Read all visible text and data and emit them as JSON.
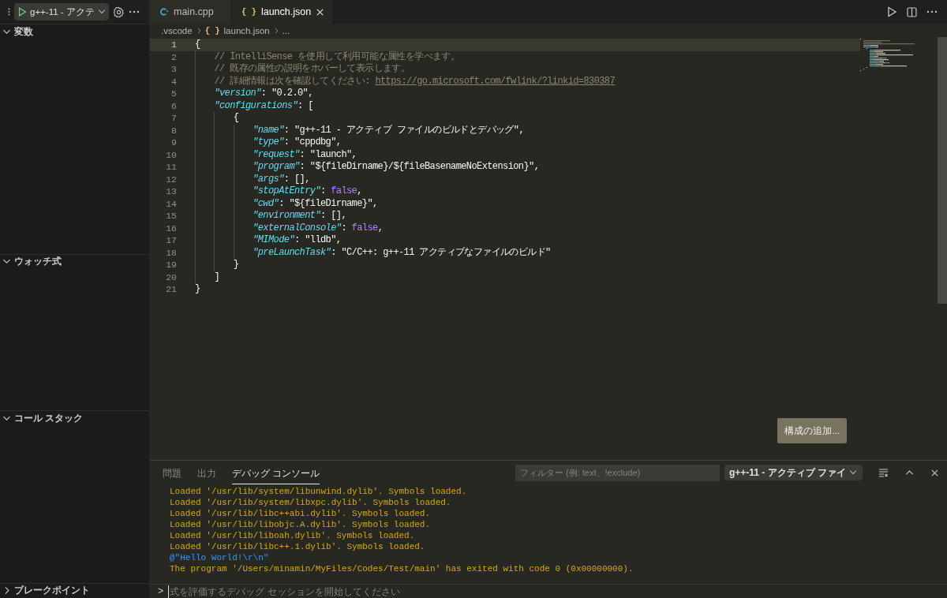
{
  "debug_toolbar": {
    "configuration": "g++-11 - アクテ"
  },
  "sidebar": {
    "sections": [
      {
        "title": "変数",
        "expanded": true
      },
      {
        "title": "ウォッチ式",
        "expanded": true
      },
      {
        "title": "コール スタック",
        "expanded": true
      },
      {
        "title": "ブレークポイント",
        "expanded": false
      }
    ]
  },
  "tabs": [
    {
      "label": "main.cpp",
      "kind": "cpp",
      "selected": false
    },
    {
      "label": "launch.json",
      "kind": "json",
      "icon_text": "{ }",
      "selected": true
    }
  ],
  "breadcrumb": [
    {
      "label": ".vscode"
    },
    {
      "label": "launch.json",
      "icon_text": "{ }"
    },
    {
      "label": "..."
    }
  ],
  "editor": {
    "lines": [
      {
        "number": "1",
        "current": true,
        "tokens": [
          {
            "t": "{",
            "kind": "punct"
          }
        ]
      },
      {
        "number": "2",
        "current": false,
        "tokens": [
          {
            "t": "    // IntelliSense を使用して利用可能な属性を学べます。",
            "kind": "comment"
          }
        ]
      },
      {
        "number": "3",
        "current": false,
        "tokens": [
          {
            "t": "    // 既存の属性の説明をホバーして表示します。",
            "kind": "comment"
          }
        ]
      },
      {
        "number": "4",
        "current": false,
        "tokens": [
          {
            "t": "    // 詳細情報は次を確認してください: ",
            "kind": "comment"
          },
          {
            "t": "https://go.microsoft.com/fwlink/?linkid=830387",
            "kind": "link"
          }
        ]
      },
      {
        "number": "5",
        "current": false,
        "tokens": [
          {
            "t": "    \"version\"",
            "kind": "key"
          },
          {
            "t": ": \"0.2.0\",",
            "kind": "punct"
          }
        ]
      },
      {
        "number": "6",
        "current": false,
        "tokens": [
          {
            "t": "    \"configurations\"",
            "kind": "key"
          },
          {
            "t": ": [",
            "kind": "punct"
          }
        ]
      },
      {
        "number": "7",
        "current": false,
        "tokens": [
          {
            "t": "        {",
            "kind": "punct"
          }
        ]
      },
      {
        "number": "8",
        "current": false,
        "tokens": [
          {
            "t": "            \"name\"",
            "kind": "key"
          },
          {
            "t": ": \"g++-11 - アクティブ ファイルのビルドとデバッグ\",",
            "kind": "punct"
          }
        ]
      },
      {
        "number": "9",
        "current": false,
        "tokens": [
          {
            "t": "            \"type\"",
            "kind": "key"
          },
          {
            "t": ": \"cppdbg\",",
            "kind": "punct"
          }
        ]
      },
      {
        "number": "10",
        "current": false,
        "tokens": [
          {
            "t": "            \"request\"",
            "kind": "key"
          },
          {
            "t": ": \"launch\",",
            "kind": "punct"
          }
        ]
      },
      {
        "number": "11",
        "current": false,
        "tokens": [
          {
            "t": "            \"program\"",
            "kind": "key"
          },
          {
            "t": ": \"${fileDirname}/${fileBasenameNoExtension}\",",
            "kind": "punct"
          }
        ]
      },
      {
        "number": "12",
        "current": false,
        "tokens": [
          {
            "t": "            \"args\"",
            "kind": "key"
          },
          {
            "t": ": [],",
            "kind": "punct"
          }
        ]
      },
      {
        "number": "13",
        "current": false,
        "tokens": [
          {
            "t": "            \"stopAtEntry\"",
            "kind": "key"
          },
          {
            "t": ": ",
            "kind": "punct"
          },
          {
            "t": "false",
            "kind": "keyword"
          },
          {
            "t": ",",
            "kind": "punct"
          }
        ]
      },
      {
        "number": "14",
        "current": false,
        "tokens": [
          {
            "t": "            \"cwd\"",
            "kind": "key"
          },
          {
            "t": ": \"${fileDirname}\",",
            "kind": "punct"
          }
        ]
      },
      {
        "number": "15",
        "current": false,
        "tokens": [
          {
            "t": "            \"environment\"",
            "kind": "key"
          },
          {
            "t": ": [],",
            "kind": "punct"
          }
        ]
      },
      {
        "number": "16",
        "current": false,
        "tokens": [
          {
            "t": "            \"externalConsole\"",
            "kind": "key"
          },
          {
            "t": ": ",
            "kind": "punct"
          },
          {
            "t": "false",
            "kind": "keyword"
          },
          {
            "t": ",",
            "kind": "punct"
          }
        ]
      },
      {
        "number": "17",
        "current": false,
        "tokens": [
          {
            "t": "            \"MIMode\"",
            "kind": "key"
          },
          {
            "t": ": \"lldb\",",
            "kind": "punct"
          }
        ]
      },
      {
        "number": "18",
        "current": false,
        "tokens": [
          {
            "t": "            \"preLaunchTask\"",
            "kind": "key"
          },
          {
            "t": ": \"C/C++: g++-11 アクティブなファイルのビルド\"",
            "kind": "punct"
          }
        ]
      },
      {
        "number": "19",
        "current": false,
        "tokens": [
          {
            "t": "        }",
            "kind": "punct"
          }
        ]
      },
      {
        "number": "20",
        "current": false,
        "tokens": [
          {
            "t": "    ]",
            "kind": "punct"
          }
        ]
      },
      {
        "number": "21",
        "current": false,
        "tokens": [
          {
            "t": "}",
            "kind": "punct"
          }
        ]
      }
    ]
  },
  "add_configuration_button": "構成の追加...",
  "panel": {
    "tabs": [
      {
        "label": "問題",
        "selected": false
      },
      {
        "label": "出力",
        "selected": false
      },
      {
        "label": "デバッグ コンソール",
        "selected": true
      }
    ],
    "filter": {
      "placeholder": "フィルター (例: text、!exclude)"
    },
    "session": "g++-11 - アクティブ ファイ",
    "lines": [
      {
        "kind": "log",
        "text": "Loaded '/usr/lib/system/libunwind.dylib'. Symbols loaded."
      },
      {
        "kind": "log",
        "text": "Loaded '/usr/lib/system/libxpc.dylib'. Symbols loaded."
      },
      {
        "kind": "log",
        "text": "Loaded '/usr/lib/libc++abi.dylib'. Symbols loaded."
      },
      {
        "kind": "log",
        "text": "Loaded '/usr/lib/libobjc.A.dylib'. Symbols loaded."
      },
      {
        "kind": "log",
        "text": "Loaded '/usr/lib/liboah.dylib'. Symbols loaded."
      },
      {
        "kind": "log",
        "text": "Loaded '/usr/lib/libc++.1.dylib'. Symbols loaded."
      },
      {
        "kind": "output",
        "text": "@\"Hello World!\\r\\n\""
      },
      {
        "kind": "log",
        "text": "The program '/Users/minamin/MyFiles/Codes/Test/main' has exited with code 0 (0x00000000)."
      }
    ],
    "input": {
      "prompt": ">",
      "placeholder": "式を評価するデバッグ セッションを開始してください"
    }
  }
}
